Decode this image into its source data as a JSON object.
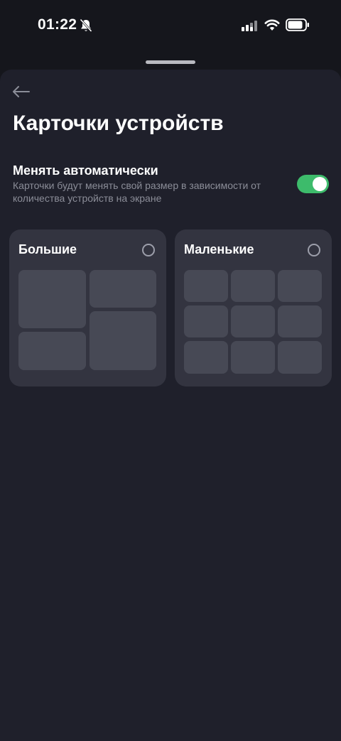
{
  "status_bar": {
    "time": "01:22"
  },
  "header": {
    "title": "Карточки устройств"
  },
  "auto_setting": {
    "label": "Менять автоматически",
    "description": "Карточки будут менять свой размер в зависимости от количества устройств на экране",
    "enabled": true
  },
  "options": [
    {
      "label": "Большие",
      "selected": false
    },
    {
      "label": "Маленькие",
      "selected": false
    }
  ],
  "colors": {
    "background": "#15161c",
    "sheet": "#1f202b",
    "card": "#333440",
    "tile": "#474955",
    "toggle_on": "#3dbb6b",
    "secondary_text": "#8b8d98"
  }
}
